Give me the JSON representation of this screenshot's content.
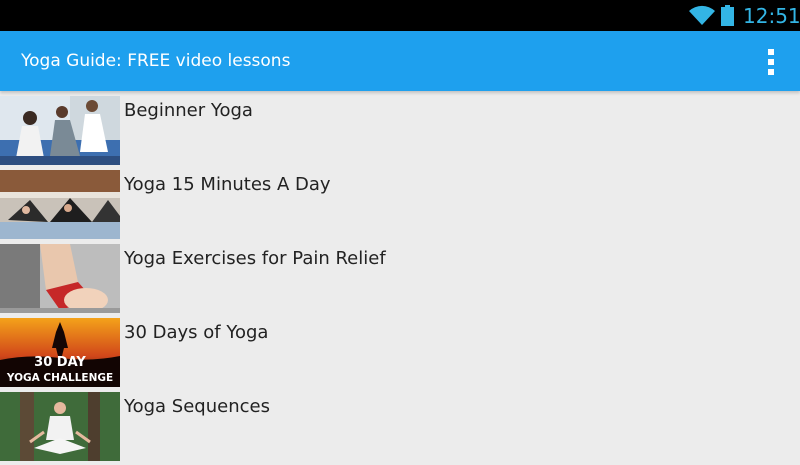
{
  "status_bar": {
    "time": "12:51",
    "icons": [
      "wifi-icon",
      "battery-icon"
    ],
    "accent_color": "#33b5e5"
  },
  "action_bar": {
    "title": "Yoga Guide: FREE video lessons",
    "background_color": "#1ea0ee",
    "menu_icon": "overflow-menu-icon"
  },
  "lessons": [
    {
      "title": "Beginner Yoga",
      "thumbnail": "beginner-yoga-thumbnail"
    },
    {
      "title": "Yoga 15 Minutes A Day",
      "thumbnail": "yoga-15-minutes-thumbnail"
    },
    {
      "title": "Yoga Exercises for Pain Relief",
      "thumbnail": "pain-relief-thumbnail"
    },
    {
      "title": "30 Days of Yoga",
      "thumbnail": "30-day-challenge-thumbnail",
      "thumbnail_text": [
        "30 DAY",
        "YOGA CHALLENGE"
      ]
    },
    {
      "title": "Yoga Sequences",
      "thumbnail": "yoga-sequences-thumbnail"
    }
  ]
}
